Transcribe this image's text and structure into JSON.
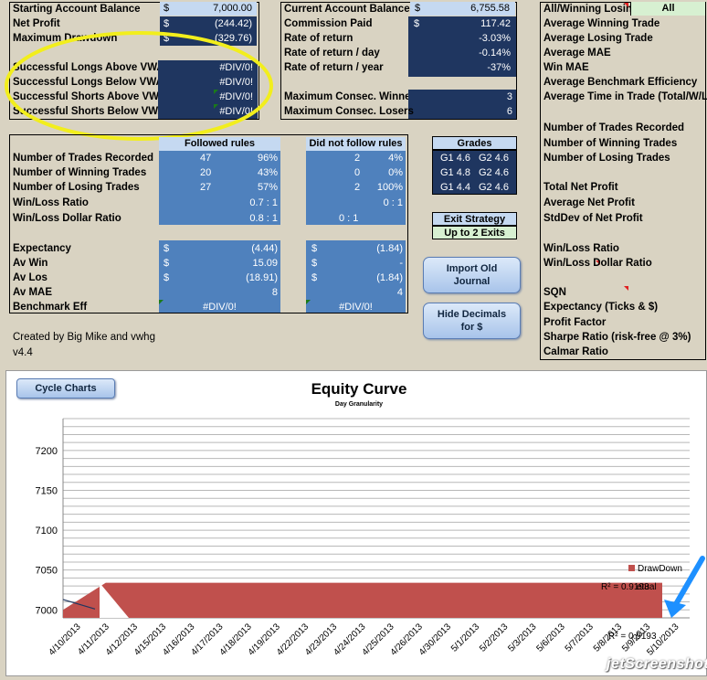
{
  "left_stats": {
    "starting_balance_label": "Starting Account Balance",
    "starting_balance_cur": "$",
    "starting_balance_value": "7,000.00",
    "net_profit_label": "Net Profit",
    "net_profit_cur": "$",
    "net_profit_value": "(244.42)",
    "max_drawdown_label": "Maximum Drawdown",
    "max_drawdown_cur": "$",
    "max_drawdown_value": "(329.76)",
    "vwap_rows": [
      {
        "label": "Successful Longs Above VWAP",
        "value": "#DIV/0!"
      },
      {
        "label": "Successful Longs Below VWAP",
        "value": "#DIV/0!"
      },
      {
        "label": "Successful Shorts Above VWAP",
        "value": "#DIV/0!"
      },
      {
        "label": "Successful Shorts Below VWAP",
        "value": "#DIV/0!"
      }
    ]
  },
  "middle_stats": {
    "current_balance_label": "Current Account Balance",
    "current_balance_cur": "$",
    "current_balance_value": "6,755.58",
    "commission_label": "Commission Paid",
    "commission_cur": "$",
    "commission_value": "117.42",
    "rate_return_label": "Rate of return",
    "rate_return_value": "-3.03%",
    "rate_day_label": "Rate of return / day",
    "rate_day_value": "-0.14%",
    "rate_year_label": "Rate of return / year",
    "rate_year_value": "-37%",
    "consec_winners_label": "Maximum Consec. Winners",
    "consec_winners_value": "3",
    "consec_losers_label": "Maximum Consec. Losers",
    "consec_losers_value": "6"
  },
  "rules_table": {
    "followed_header": "Followed rules",
    "not_followed_header": "Did not follow rules",
    "rows": [
      {
        "label": "Number of Trades Recorded",
        "f1": "47",
        "f2": "96%",
        "n1": "2",
        "n2": "4%"
      },
      {
        "label": "Number of Winning Trades",
        "f1": "20",
        "f2": "43%",
        "n1": "0",
        "n2": "0%"
      },
      {
        "label": "Number of Losing Trades",
        "f1": "27",
        "f2": "57%",
        "n1": "2",
        "n2": "100%"
      },
      {
        "label": "Win/Loss Ratio",
        "f1": "",
        "f2": "0.7 : 1",
        "n1": "",
        "n2": "0 : 1"
      },
      {
        "label": "Win/Loss Dollar Ratio",
        "f1": "",
        "f2": "0.8 : 1",
        "n1": "0 : 1",
        "n2": ""
      }
    ],
    "money_rows": [
      {
        "label": "Expectancy",
        "fc": "$",
        "fv": "(4.44)",
        "nc": "$",
        "nv": "(1.84)"
      },
      {
        "label": "Av Win",
        "fc": "$",
        "fv": "15.09",
        "nc": "$",
        "nv": "-"
      },
      {
        "label": "Av Los",
        "fc": "$",
        "fv": "(18.91)",
        "nc": "$",
        "nv": "(1.84)"
      },
      {
        "label": "Av MAE",
        "fc": "",
        "fv": "8",
        "nc": "",
        "nv": "4"
      },
      {
        "label": "Benchmark Eff",
        "fc": "",
        "fv": "#DIV/0!",
        "nc": "",
        "nv": "#DIV/0!"
      }
    ]
  },
  "grades": {
    "header": "Grades",
    "rows": [
      {
        "g1": "G1 4.6",
        "g2": "G2 4.6"
      },
      {
        "g1": "G1 4.8",
        "g2": "G2 4.6"
      },
      {
        "g1": "G1 4.4",
        "g2": "G2 4.6"
      }
    ]
  },
  "exit_strategy": {
    "label": "Exit Strategy",
    "value": "Up to 2 Exits"
  },
  "buttons": {
    "import_journal": "Import Old Journal",
    "hide_decimals": "Hide Decimals for $",
    "cycle_charts": "Cycle Charts"
  },
  "credits": {
    "line1": "Created by Big Mike and vwhg",
    "line2": "v4.4"
  },
  "right_panel": {
    "filter_label": "All/Winning Losing",
    "filter_value": "All",
    "items_top": [
      "Average Winning Trade",
      "Average Losing Trade",
      "Average MAE",
      "Win MAE",
      "Average Benchmark Efficiency",
      "Average Time in Trade (Total/W/L)"
    ],
    "items_trades": [
      "Number of Trades Recorded",
      "Number of Winning Trades",
      "Number of Losing Trades"
    ],
    "items_profit": [
      "Total Net Profit",
      "Average Net Profit",
      "StdDev of Net Profit"
    ],
    "items_ratio": [
      "Win/Loss Ratio",
      "Win/Loss Dollar Ratio"
    ],
    "items_bottom": [
      "SQN",
      "Expectancy (Ticks & $)",
      "Profit Factor",
      "Sharpe Ratio (risk-free @ 3%)",
      "Calmar Ratio"
    ]
  },
  "chart_data": {
    "type": "area",
    "title": "Equity Curve",
    "subtitle": "Day Granularity",
    "x": [
      "4/10/2013",
      "4/11/2013",
      "4/12/2013",
      "4/15/2013",
      "4/16/2013",
      "4/17/2013",
      "4/18/2013",
      "4/19/2013",
      "4/22/2013",
      "4/23/2013",
      "4/24/2013",
      "4/25/2013",
      "4/26/2013",
      "4/30/2013",
      "5/1/2013",
      "5/2/2013",
      "5/3/2013",
      "5/6/2013",
      "5/7/2013",
      "5/8/2013",
      "5/9/2013",
      "5/10/2013"
    ],
    "ylim": [
      6990,
      7240
    ],
    "yticks": [
      7000,
      7050,
      7100,
      7150,
      7200
    ],
    "series": [
      {
        "name": "DrawDown",
        "color": "#c0504d",
        "values": [
          7000,
          7034,
          7034,
          7034,
          7034,
          7034,
          7034,
          7034,
          7034,
          7034,
          7034,
          7034,
          7034,
          7034,
          7034,
          7034,
          7034,
          7034,
          7034,
          7034,
          7034,
          7034
        ]
      },
      {
        "name": "",
        "color": "#1f3660",
        "values": [
          7013,
          7000
        ]
      }
    ],
    "r2_labels": [
      "R² = 0.9193",
      "R² = 0.9193"
    ],
    "legend_tail": "etual",
    "grid": true,
    "legend": "right"
  },
  "watermark": "jetScreenshot"
}
